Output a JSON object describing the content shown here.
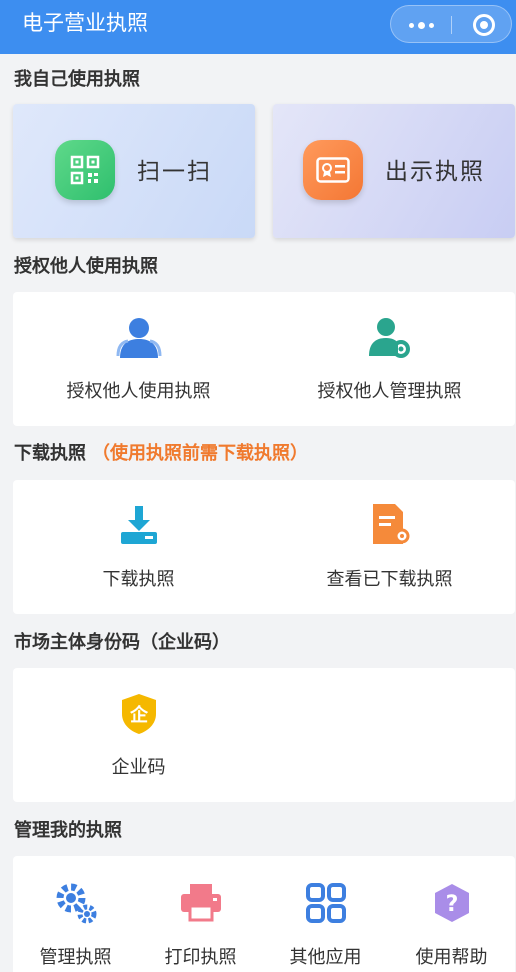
{
  "header": {
    "title": "电子营业执照"
  },
  "sections": {
    "my_use": {
      "title": "我自己使用执照",
      "scan_label": "扫一扫",
      "show_label": "出示执照"
    },
    "authorize": {
      "title": "授权他人使用执照",
      "items": [
        "授权他人使用执照",
        "授权他人管理执照"
      ]
    },
    "download": {
      "title": "下载执照",
      "note": "（使用执照前需下载执照）",
      "items": [
        "下载执照",
        "查看已下载执照"
      ]
    },
    "entity_code": {
      "title": "市场主体身份码（企业码）",
      "items": [
        "企业码"
      ],
      "icon_char": "企"
    },
    "manage": {
      "title": "管理我的执照",
      "items": [
        "管理执照",
        "打印执照",
        "其他应用",
        "使用帮助"
      ]
    }
  },
  "icons": [
    "more-dots-icon",
    "target-icon",
    "qr-code-icon",
    "license-card-icon",
    "users-icon",
    "user-gear-icon",
    "download-tray-icon",
    "document-view-icon",
    "shield-icon",
    "gears-icon",
    "printer-icon",
    "grid-apps-icon",
    "help-question-icon"
  ],
  "colors": {
    "brand": "#3d8ef0",
    "accent_orange": "#f07a2e",
    "green": "#2fbf6e",
    "yellow": "#f5b800",
    "purple": "#a98de8",
    "pink": "#f27a8a"
  }
}
